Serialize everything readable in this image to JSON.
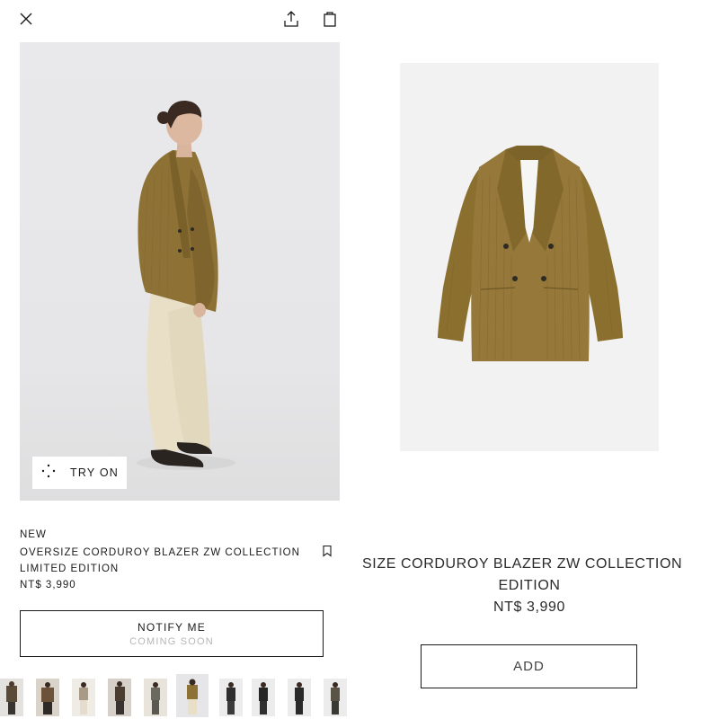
{
  "left_panel": {
    "topbar": {
      "close_icon": "close-icon",
      "share_icon": "share-icon",
      "bag_icon": "shopping-bag-icon"
    },
    "try_on": {
      "icon": "sparkle-dots-icon",
      "label": "TRY ON"
    },
    "product": {
      "badge": "NEW",
      "name": "OVERSIZE CORDUROY BLAZER ZW COLLECTION LIMITED EDITION",
      "price": "NT$ 3,990",
      "bookmark_icon": "bookmark-icon"
    },
    "notify_button": {
      "label": "NOTIFY ME",
      "sublabel": "COMING SOON"
    },
    "thumbnails": [
      {
        "id": "thumb-1"
      },
      {
        "id": "thumb-2"
      },
      {
        "id": "thumb-3"
      },
      {
        "id": "thumb-4"
      },
      {
        "id": "thumb-5"
      },
      {
        "id": "thumb-6",
        "selected": true
      },
      {
        "id": "thumb-7"
      },
      {
        "id": "thumb-8"
      },
      {
        "id": "thumb-9"
      },
      {
        "id": "thumb-10"
      }
    ]
  },
  "right_panel": {
    "title_line1": "SIZE CORDUROY BLAZER ZW COLLECTION",
    "title_line2": "EDITION",
    "price": "NT$ 3,990",
    "add_button": {
      "label": "ADD"
    }
  },
  "colors": {
    "blazer": "#8e7235",
    "trousers": "#e8dfc6",
    "border": "#1a1a1a",
    "muted_text": "#b6b6b6"
  }
}
